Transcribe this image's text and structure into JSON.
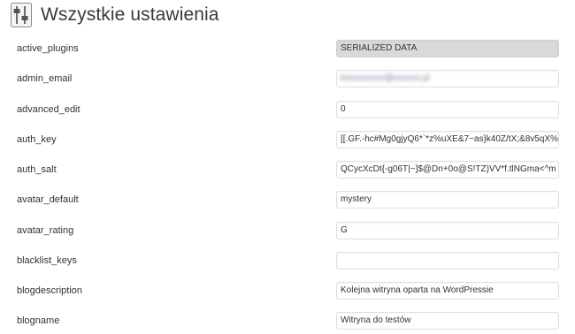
{
  "header": {
    "title": "Wszystkie ustawienia",
    "icon": "settings-sliders-icon"
  },
  "options": [
    {
      "name": "active_plugins",
      "value": "SERIALIZED DATA",
      "serialized": true
    },
    {
      "name": "admin_email",
      "value": "kxxxxxxxxx@xxxxxx.pl",
      "obscured": true
    },
    {
      "name": "advanced_edit",
      "value": "0"
    },
    {
      "name": "auth_key",
      "value": "[[.GF.-hc#Mg0gjyQ6*`*z%uXE&7~as}k40Z/tX;&8v5qX%"
    },
    {
      "name": "auth_salt",
      "value": "QCycXcDt{-g06T|~]$@Dn+0o@S!TZ)VV*f.tlNGma<^m"
    },
    {
      "name": "avatar_default",
      "value": "mystery"
    },
    {
      "name": "avatar_rating",
      "value": "G"
    },
    {
      "name": "blacklist_keys",
      "value": ""
    },
    {
      "name": "blogdescription",
      "value": "Kolejna witryna oparta na WordPressie"
    },
    {
      "name": "blogname",
      "value": "Witryna do testów"
    }
  ]
}
